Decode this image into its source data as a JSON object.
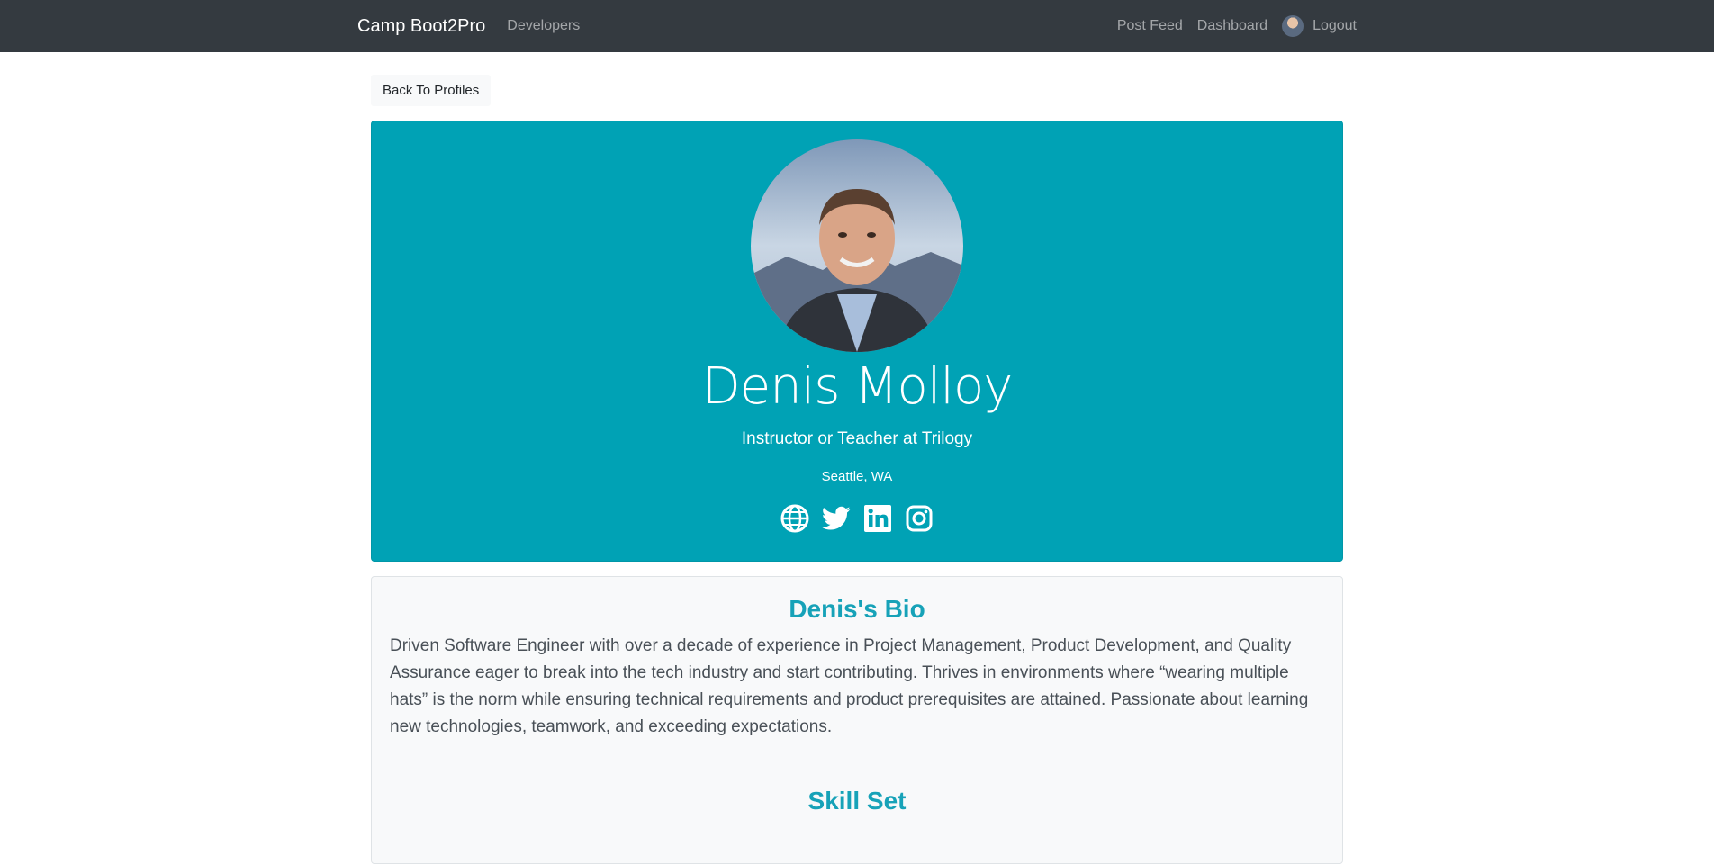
{
  "navbar": {
    "brand": "Camp Boot2Pro",
    "developers": "Developers",
    "post_feed": "Post Feed",
    "dashboard": "Dashboard",
    "logout": "Logout"
  },
  "back_button": "Back To Profiles",
  "profile": {
    "name": "Denis Molloy",
    "title": "Instructor or Teacher at Trilogy",
    "location": "Seattle, WA",
    "social_icons": [
      "globe-icon",
      "twitter-icon",
      "linkedin-icon",
      "instagram-icon"
    ]
  },
  "bio": {
    "heading": "Denis's Bio",
    "text": "Driven Software Engineer with over a decade of experience in Project Management, Product Development, and Quality Assurance eager to break into the tech industry and start contributing. Thrives in environments where “wearing multiple hats” is the norm while ensuring technical requirements and product prerequisites are attained. Passionate about learning new technologies, teamwork, and exceeding expectations."
  },
  "skills": {
    "heading": "Skill Set"
  },
  "colors": {
    "navbar": "#343a40",
    "profile_card": "#00a2b5",
    "accent": "#17a2b8"
  }
}
